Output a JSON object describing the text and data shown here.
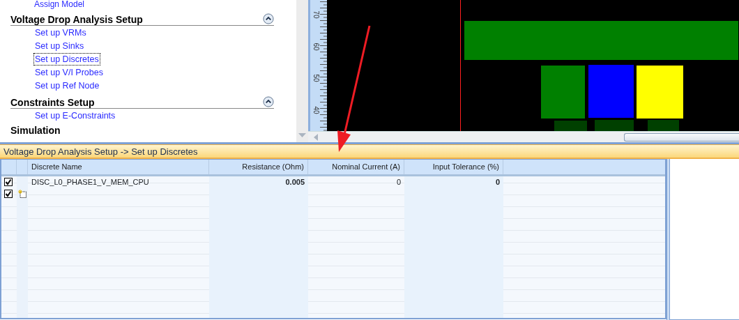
{
  "sidebar": {
    "top_link": "Assign Model",
    "sections": [
      {
        "title": "Voltage Drop Analysis Setup",
        "expanded": true,
        "items": [
          {
            "label": "Set up VRMs",
            "selected": false
          },
          {
            "label": "Set up Sinks",
            "selected": false
          },
          {
            "label": "Set up Discretes",
            "selected": true
          },
          {
            "label": "Set up V/I Probes",
            "selected": false
          },
          {
            "label": "Set up Ref Node",
            "selected": false
          }
        ]
      },
      {
        "title": "Constraints Setup",
        "expanded": true,
        "items": [
          {
            "label": "Set up E-Constraints",
            "selected": false
          }
        ]
      },
      {
        "title": "Simulation"
      }
    ]
  },
  "ruler": {
    "labels": [
      "70",
      "60",
      "50",
      "40"
    ]
  },
  "panel_title": "Voltage Drop Analysis Setup -> Set up Discretes",
  "table": {
    "columns": [
      {
        "label": "Discrete Name",
        "kind": "text",
        "editable": false
      },
      {
        "label": "Resistance (Ohm)",
        "kind": "number",
        "editable": true
      },
      {
        "label": "Nominal Current (A)",
        "kind": "number",
        "editable": false
      },
      {
        "label": "Input Tolerance (%)",
        "kind": "number",
        "editable": true
      }
    ],
    "rows": [
      {
        "checked": true,
        "new": false,
        "cells": [
          "DISC_L0_PHASE1_V_MEM_CPU",
          "0.005",
          "0",
          "0"
        ]
      },
      {
        "checked": true,
        "new": true,
        "cells": []
      }
    ]
  }
}
